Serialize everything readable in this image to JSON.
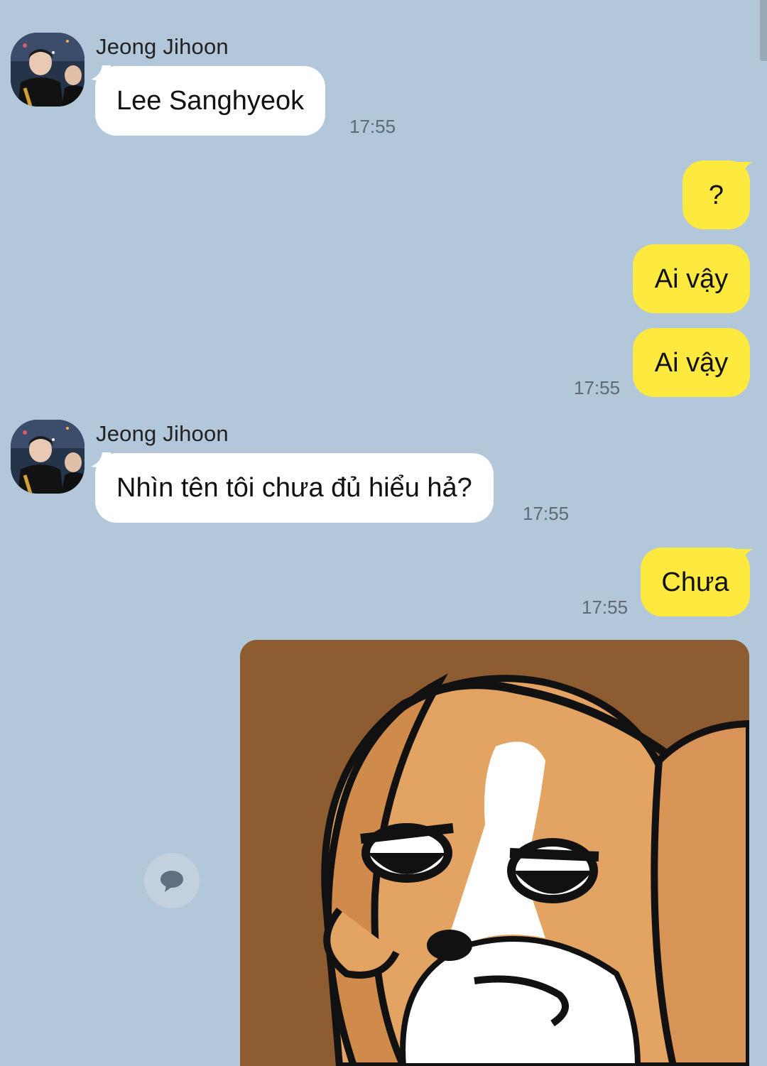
{
  "chat": {
    "messages": [
      {
        "sender": "Jeong Jihoon",
        "text": "Lee Sanghyeok",
        "time": "17:55"
      },
      {
        "text": "?"
      },
      {
        "text": "Ai vậy"
      },
      {
        "text": "Ai vậy",
        "time": "17:55"
      },
      {
        "sender": "Jeong Jihoon",
        "text": "Nhìn tên tôi chưa đủ hiểu hả?",
        "time": "17:55"
      },
      {
        "text": "Chưa",
        "time": "17:55"
      }
    ],
    "sticker_icon": "sleepy-dog-sticker",
    "reply_icon": "chat-bubble-icon"
  },
  "colors": {
    "background": "#b2c7da",
    "incoming_bubble": "#ffffff",
    "outgoing_bubble": "#fee93f",
    "timestamp": "#5e6a76"
  }
}
